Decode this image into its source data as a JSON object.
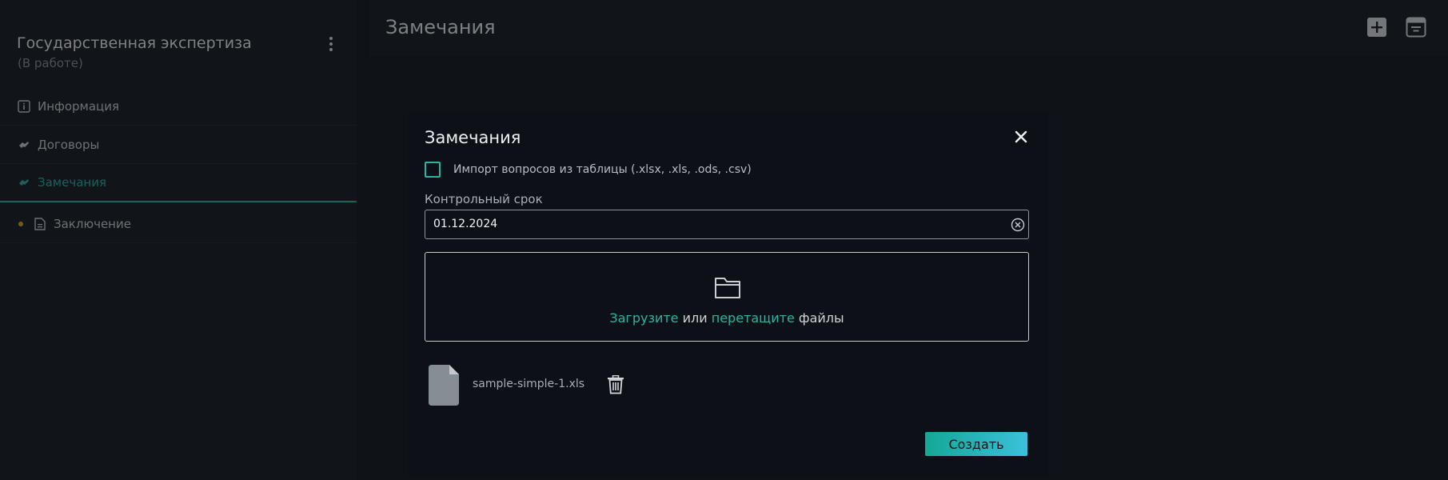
{
  "sidebar": {
    "project_title": "Государственная экспертиза",
    "project_status": "(В работе)",
    "items": [
      {
        "label": "Информация",
        "icon": "info-icon"
      },
      {
        "label": "Договоры",
        "icon": "handshake-icon"
      },
      {
        "label": "Замечания",
        "icon": "handshake-icon",
        "active": true
      },
      {
        "label": "Заключение",
        "icon": "document-icon",
        "dot": "#d9a53a"
      }
    ]
  },
  "topbar": {
    "title": "Замечания",
    "icons": [
      "add-box-icon",
      "filter-icon"
    ]
  },
  "modal": {
    "title": "Замечания",
    "import_checkbox_label": "Импорт вопросов из таблицы (.xlsx, .xls, .ods, .csv)",
    "import_checked": false,
    "deadline_label": "Контрольный срок",
    "deadline_value": "01.12.2024",
    "dropzone": {
      "upload": "Загрузите",
      "or": "или",
      "drag": "перетащите",
      "files": "файлы"
    },
    "file_name": "sample-simple-1.xls",
    "create_label": "Создать"
  },
  "colors": {
    "accent": "#2fb3a1",
    "background": "#1c222a",
    "modal": "#0d1117"
  }
}
